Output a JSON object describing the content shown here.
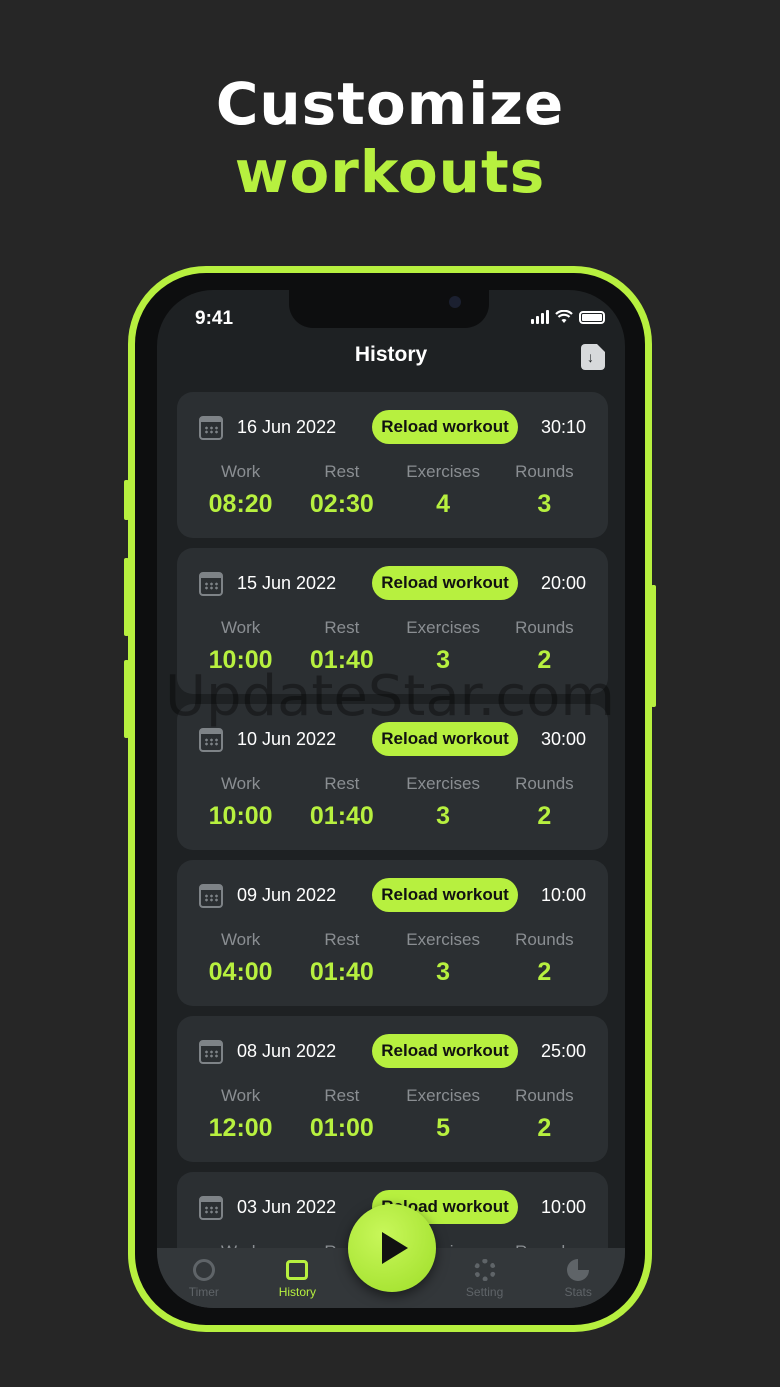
{
  "headline": {
    "line1": "Customize",
    "line2": "workouts"
  },
  "status_bar": {
    "time": "9:41"
  },
  "header": {
    "title": "History",
    "export_icon": "file-download-icon"
  },
  "labels": {
    "work": "Work",
    "rest": "Rest",
    "exercises": "Exercises",
    "rounds": "Rounds",
    "reload": "Reload workout"
  },
  "history": [
    {
      "date": "16 Jun 2022",
      "total": "30:10",
      "work": "08:20",
      "rest": "02:30",
      "exercises": "4",
      "rounds": "3"
    },
    {
      "date": "15 Jun 2022",
      "total": "20:00",
      "work": "10:00",
      "rest": "01:40",
      "exercises": "3",
      "rounds": "2"
    },
    {
      "date": "10 Jun 2022",
      "total": "30:00",
      "work": "10:00",
      "rest": "01:40",
      "exercises": "3",
      "rounds": "2"
    },
    {
      "date": "09 Jun 2022",
      "total": "10:00",
      "work": "04:00",
      "rest": "01:40",
      "exercises": "3",
      "rounds": "2"
    },
    {
      "date": "08 Jun 2022",
      "total": "25:00",
      "work": "12:00",
      "rest": "01:00",
      "exercises": "5",
      "rounds": "2"
    },
    {
      "date": "03 Jun 2022",
      "total": "10:00",
      "work": "",
      "rest": "",
      "exercises": "",
      "rounds": ""
    }
  ],
  "tabbar": {
    "timer": "Timer",
    "history": "History",
    "setting": "Setting",
    "stats": "Stats"
  },
  "watermark": "UpdateStar.com",
  "colors": {
    "accent": "#b7f03f",
    "background": "#262626",
    "card": "#2b2f32"
  }
}
